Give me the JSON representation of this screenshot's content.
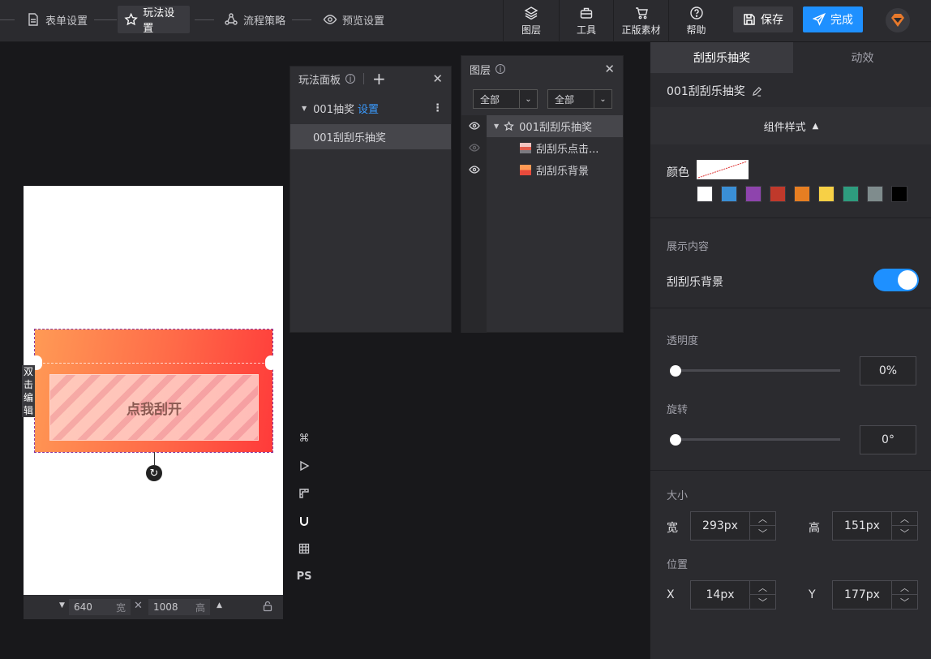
{
  "topbar": {
    "steps": [
      {
        "label": "表单设置",
        "icon": "form-icon"
      },
      {
        "label": "玩法设置",
        "icon": "star-icon",
        "active": true
      },
      {
        "label": "流程策略",
        "icon": "flow-icon"
      },
      {
        "label": "预览设置",
        "icon": "eye-icon"
      }
    ],
    "tools": [
      {
        "label": "图层",
        "icon": "layers-icon"
      },
      {
        "label": "工具",
        "icon": "toolbox-icon"
      },
      {
        "label": "正版素材",
        "icon": "cart-icon"
      },
      {
        "label": "帮助",
        "icon": "help-icon"
      }
    ],
    "save_label": "保存",
    "done_label": "完成",
    "accent": "#1e90ff",
    "logo_color": "#e8792b"
  },
  "canvas": {
    "scratch_text": "点我刮开",
    "dblclick_label": "双击编辑",
    "width_value": "640",
    "width_unit": "宽",
    "height_value": "1008",
    "height_unit": "高"
  },
  "side_tools": [
    "command-icon",
    "play-icon",
    "ruler-icon",
    "magnet-icon",
    "grid-icon",
    "PS"
  ],
  "play_panel": {
    "title": "玩法面板",
    "group_label": "001抽奖",
    "group_link": "设置",
    "item_label": "001刮刮乐抽奖"
  },
  "layer_panel": {
    "title": "图层",
    "filter1": "全部",
    "filter2": "全部",
    "root": "001刮刮乐抽奖",
    "children": [
      "刮刮乐点击...",
      "刮刮乐背景"
    ]
  },
  "right": {
    "tab_active": "刮刮乐抽奖",
    "tab_other": "动效",
    "component_name": "001刮刮乐抽奖",
    "section_title": "组件样式",
    "color_label": "颜色",
    "swatches": [
      "#ffffff",
      "#3a8fd6",
      "#8e44ad",
      "#c0392b",
      "#e67e22",
      "#f7d046",
      "#2e9c7e",
      "#7f8c8d",
      "#000000"
    ],
    "display_label": "展示内容",
    "toggle_label": "刮刮乐背景",
    "toggle_on": true,
    "opacity_label": "透明度",
    "opacity_value": "0%",
    "rotate_label": "旋转",
    "rotate_value": "0°",
    "size_label": "大小",
    "width_label": "宽",
    "width_value": "293px",
    "height_label": "高",
    "height_value": "151px",
    "position_label": "位置",
    "x_label": "X",
    "x_value": "14px",
    "y_label": "Y",
    "y_value": "177px"
  }
}
